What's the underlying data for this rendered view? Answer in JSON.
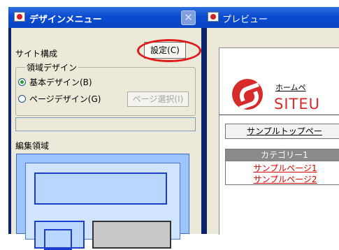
{
  "design_window": {
    "title": "デザインメニュー",
    "close_symbol": "✕",
    "site_label": "サイト構成",
    "settings_button": "設定(C)",
    "region_group": {
      "legend": "領域デザイン",
      "options": [
        "基本デザイン(B)",
        "ページデザイン(G)"
      ],
      "selected": "基本デザイン(B)",
      "page_select_button": "ページ選択(I)"
    },
    "edit_area_label": "編集領域"
  },
  "preview_window": {
    "title": "プレビュー",
    "home_link": "ホームペ",
    "brand": "SITEU",
    "sample_top_link": "サンプルトップペー",
    "category": "カテゴリー1",
    "links": [
      "サンプルページ1",
      "サンプルページ2"
    ]
  },
  "colors": {
    "title_bar": "#0b4bd0",
    "highlight": "#e01a1a",
    "brand_red": "#d72a2a",
    "link_red": "#d40000"
  },
  "icons": [
    "app-icon",
    "close-icon",
    "radio-icon",
    "logo-icon"
  ]
}
